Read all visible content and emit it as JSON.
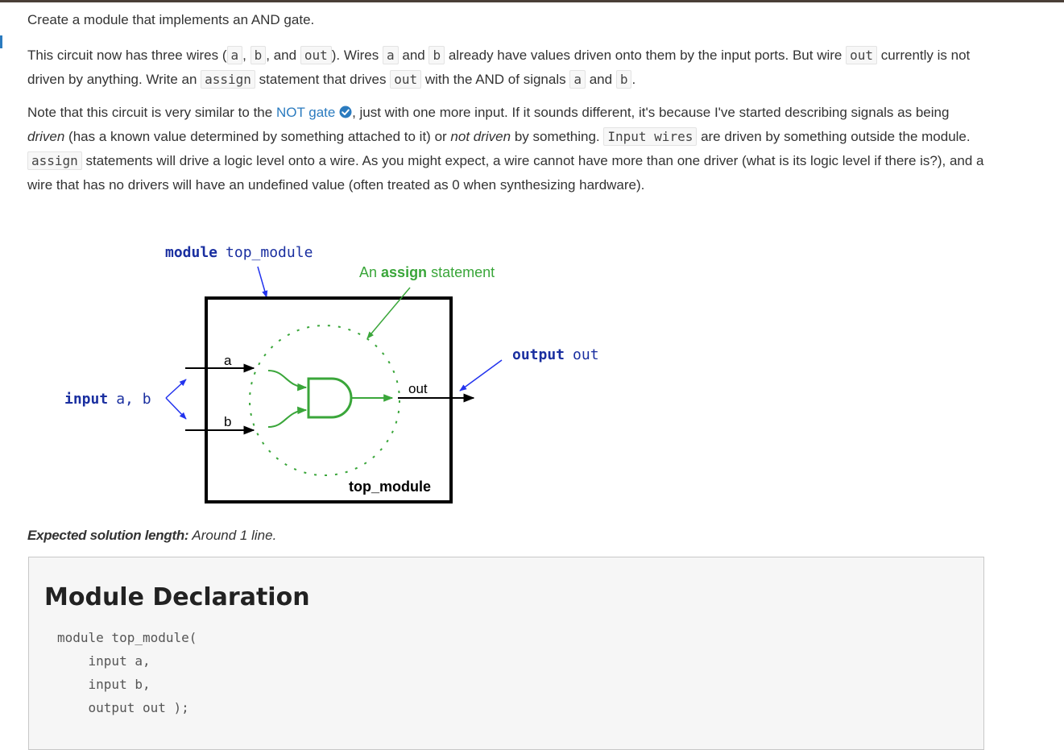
{
  "intro": "Create a module that implements an AND gate.",
  "para1": {
    "t1": "This circuit now has three wires (",
    "c_a": "a",
    "t2": ", ",
    "c_b": "b",
    "t3": ", and ",
    "c_out": "out",
    "t4": "). Wires ",
    "c_a2": "a",
    "t5": " and ",
    "c_b2": "b",
    "t6": " already have values driven onto them by the input ports. But wire ",
    "c_out2": "out",
    "t7": " currently is not driven by anything. Write an ",
    "c_assign": "assign",
    "t8": " statement that drives ",
    "c_out3": "out",
    "t9": " with the AND of signals ",
    "c_a3": "a",
    "t10": " and ",
    "c_b3": "b",
    "t11": "."
  },
  "para2": {
    "t1": "Note that this circuit is very similar to the ",
    "link": "NOT gate",
    "t2": ", just with one more input. If it sounds different, it's because I've started describing signals as being ",
    "em_driven": "driven",
    "t3": " (has a known value determined by something attached to it) or ",
    "em_not_driven": "not driven",
    "t4": " by something. ",
    "c_input_wires": "Input wires",
    "t5": " are driven by something outside the module. ",
    "c_assign": "assign",
    "t6": " statements will drive a logic level onto a wire. As you might expect, a wire cannot have more than one driver (what is its logic level if there is?), and a wire that has no drivers will have an undefined value (often treated as 0 when synthesizing hardware)."
  },
  "diagram": {
    "module_kw": "module",
    "module_name": "top_module",
    "assign_pre": "An ",
    "assign_kw": "assign",
    "assign_post": " statement",
    "input_kw": "input",
    "input_names": "a, b",
    "output_kw": "output",
    "output_name": "out",
    "wire_a": "a",
    "wire_b": "b",
    "wire_out": "out",
    "box_label": "top_module",
    "colors": {
      "keyword": "#1a2fa0",
      "green": "#3aa63a",
      "blue_arrow": "#2233ee",
      "black": "#000000"
    }
  },
  "expected": {
    "label": "Expected solution length:",
    "value": "Around 1 line."
  },
  "panel": {
    "title": "Module Declaration",
    "code": [
      "module top_module(",
      "    input a,",
      "    input b,",
      "    output out );"
    ]
  }
}
